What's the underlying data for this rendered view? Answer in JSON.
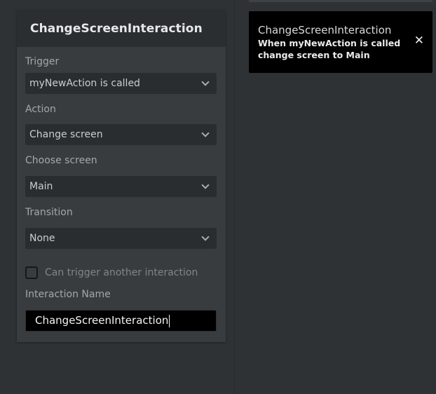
{
  "panel": {
    "title": "ChangeScreenInteraction",
    "fields": {
      "trigger": {
        "label": "Trigger",
        "value": "myNewAction is called"
      },
      "action": {
        "label": "Action",
        "value": "Change screen"
      },
      "choose_screen": {
        "label": "Choose screen",
        "value": "Main"
      },
      "transition": {
        "label": "Transition",
        "value": "None"
      }
    },
    "can_trigger": {
      "label": "Can trigger another interaction",
      "checked": false
    },
    "interaction_name": {
      "label": "Interaction Name",
      "value": "ChangeScreenInteraction"
    }
  },
  "toast": {
    "title": "ChangeScreenInteraction",
    "message": "When myNewAction is called change screen to Main",
    "close_icon": "close-icon"
  },
  "colors": {
    "background": "#2f3235",
    "panel": "#393c3f",
    "panel_header": "#2b2e31",
    "select_bg": "#2a2d30",
    "toast_bg": "#000000"
  }
}
